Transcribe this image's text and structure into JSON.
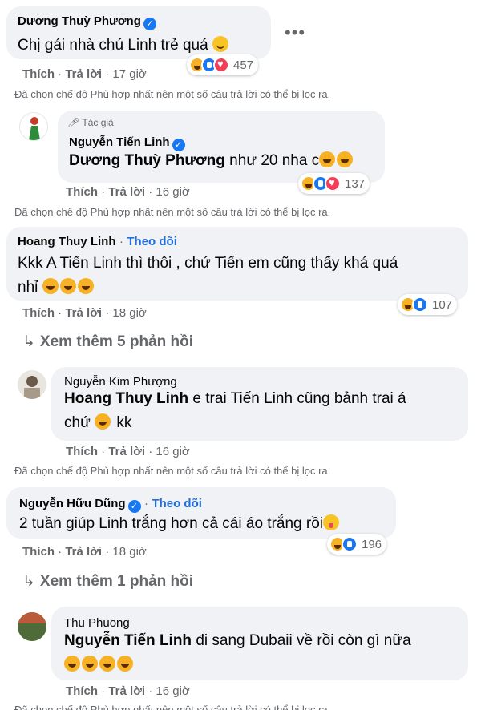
{
  "comments": {
    "c1": {
      "name": "Dương Thuỳ Phương",
      "text": "Chị gái nhà chú Linh trẻ quá",
      "like": "Thích",
      "reply": "Trả lời",
      "time": "17 giờ",
      "reaction_count": "457"
    },
    "r1": {
      "author_tag": "Tác giả",
      "name": "Nguyễn Tiến Linh",
      "mention": "Dương Thuỳ Phương",
      "text": " như 20 nha c",
      "like": "Thích",
      "reply": "Trả lời",
      "time": "16 giờ",
      "reaction_count": "137"
    },
    "c2": {
      "name": "Hoang Thuy Linh",
      "follow": "Theo dõi",
      "text_line1": "Kkk A Tiến Linh thì thôi , chứ Tiến em cũng thấy khá quá",
      "text_line2": "nhỉ",
      "like": "Thích",
      "reply": "Trả lời",
      "time": "18 giờ",
      "reaction_count": "107",
      "more_replies": "Xem thêm 5 phản hồi"
    },
    "r2": {
      "name": "Nguyễn Kim Phượng",
      "mention": "Hoang Thuy Linh",
      "text_line1": " e trai Tiến Linh cũng bảnh trai á",
      "text_line2a": "chứ",
      "text_line2b": " kk",
      "like": "Thích",
      "reply": "Trả lời",
      "time": "16 giờ"
    },
    "c3": {
      "name": "Nguyễn Hữu Dũng",
      "follow": "Theo dõi",
      "text": "2 tuần giúp Linh trắng hơn cả cái áo trắng rồi",
      "like": "Thích",
      "reply": "Trả lời",
      "time": "18 giờ",
      "reaction_count": "196",
      "more_replies": "Xem thêm 1 phản hồi"
    },
    "r3": {
      "name": "Thu Phuong",
      "mention": "Nguyễn Tiến Linh",
      "text": " đi sang Dubaii về rồi còn gì nữa",
      "like": "Thích",
      "reply": "Trả lời",
      "time": "16 giờ"
    }
  },
  "filter_note": "Đã chọn chế độ Phù hợp nhất nên một số câu trả lời có thể bị lọc ra.",
  "dot": "·",
  "menu_icon": "more-horizontal-icon",
  "colors": {
    "bubble": "#f0f2f5",
    "link_blue": "#216fdb",
    "secondary": "#65676b",
    "verified": "#1877f2"
  }
}
